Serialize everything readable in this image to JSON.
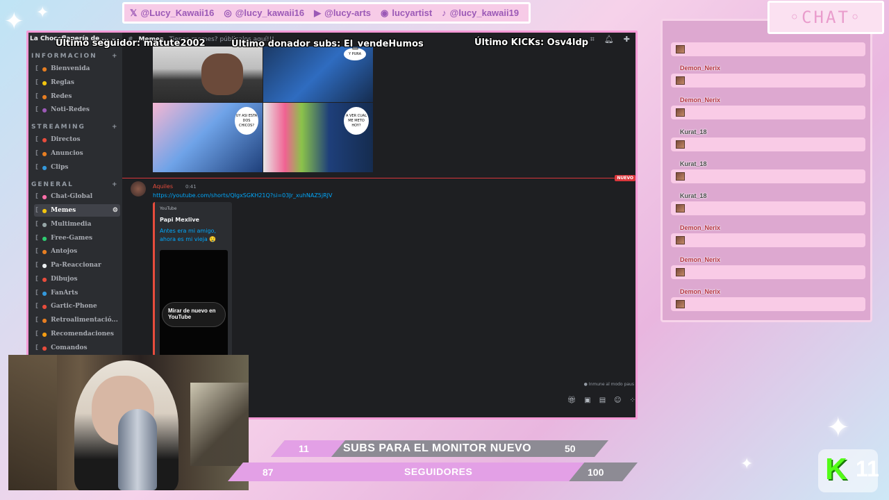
{
  "socials": [
    {
      "icon": "x-icon",
      "glyph": "𝕏",
      "handle": "@Lucy_Kawaii16"
    },
    {
      "icon": "instagram-icon",
      "glyph": "◎",
      "handle": "@lucy_kawaii16"
    },
    {
      "icon": "youtube-icon",
      "glyph": "▶",
      "handle": "@lucy-arts"
    },
    {
      "icon": "discord-icon",
      "glyph": "◉",
      "handle": "lucyartist"
    },
    {
      "icon": "tiktok-icon",
      "glyph": "♪",
      "handle": "@lucy_kawaii19"
    }
  ],
  "overlay": {
    "last_follower": "Último seguidor: matute2002",
    "last_donor": "Último donador subs: El_vendeHumos",
    "last_kicks": "Último KICKs: Osv4ldp"
  },
  "discord": {
    "server_name": "La Chocoflanería de ...",
    "categories": {
      "info": "INFORMACION",
      "streaming": "STREAMING",
      "general": "GENERAL"
    },
    "channels_info": [
      "Bienvenida",
      "Reglas",
      "Redes",
      "Noti-Redes"
    ],
    "channels_streaming": [
      "Directos",
      "Anuncios",
      "Clips"
    ],
    "channels_general": [
      "Chat-Global",
      "Memes",
      "Multimedia",
      "Free-Games",
      "Antojos",
      "Pa-Reaccionar",
      "Dibujos",
      "FanArts",
      "Gartic-Phone",
      "Retroalimentació...",
      "Recomendaciones",
      "Comandos"
    ],
    "active_channel": "Memes",
    "topic": "Tienes memes? públicalos aquí!!!",
    "new_label": "NUEVO",
    "message": {
      "author": "Aquiles",
      "time": "0:41",
      "link": "https://youtube.com/shorts/QIgxSGKH21Q?si=03Jr_xuhNAZ5jRJV",
      "embed_provider": "YouTube",
      "embed_author": "Papi Mexlive",
      "embed_title": "Antes era mi amigo, ahora es mi vieja 🤤",
      "rewatch_label": "Mirar de nuevo en YouTube"
    },
    "immune_text": "Inmune al modo paus",
    "thumb_captions": {
      "t1": "Y PURA",
      "t3": "UY ASI ESTA DOS CHICOS?",
      "t4": "A VER CUAL ME METO HOY?"
    }
  },
  "chat": {
    "title": "◦CHAT◦",
    "messages": [
      {
        "user": ""
      },
      {
        "user": "Demon_Nerix"
      },
      {
        "user": "Demon_Nerix"
      },
      {
        "user": "Kurat_18"
      },
      {
        "user": "Kurat_18"
      },
      {
        "user": "Kurat_18"
      },
      {
        "user": "Demon_Nerix"
      },
      {
        "user": "Demon_Nerix"
      },
      {
        "user": "Demon_Nerix"
      }
    ]
  },
  "goals": {
    "subs": {
      "current": "11",
      "label": "SUBS PARA EL MONITOR NUEVO",
      "target": "50",
      "progress": 0.22
    },
    "followers": {
      "current": "87",
      "label": "SEGUIDORES",
      "target": "100",
      "progress": 0.87
    }
  },
  "kick_badge": {
    "letter": "K",
    "count": "11"
  },
  "colors": {
    "accent_pink": "#f59ad6",
    "discord_bg": "#1e1f22",
    "sidebar_bg": "#2b2d31",
    "link": "#00a8fc",
    "goal_bar": "#e3a0e6"
  }
}
